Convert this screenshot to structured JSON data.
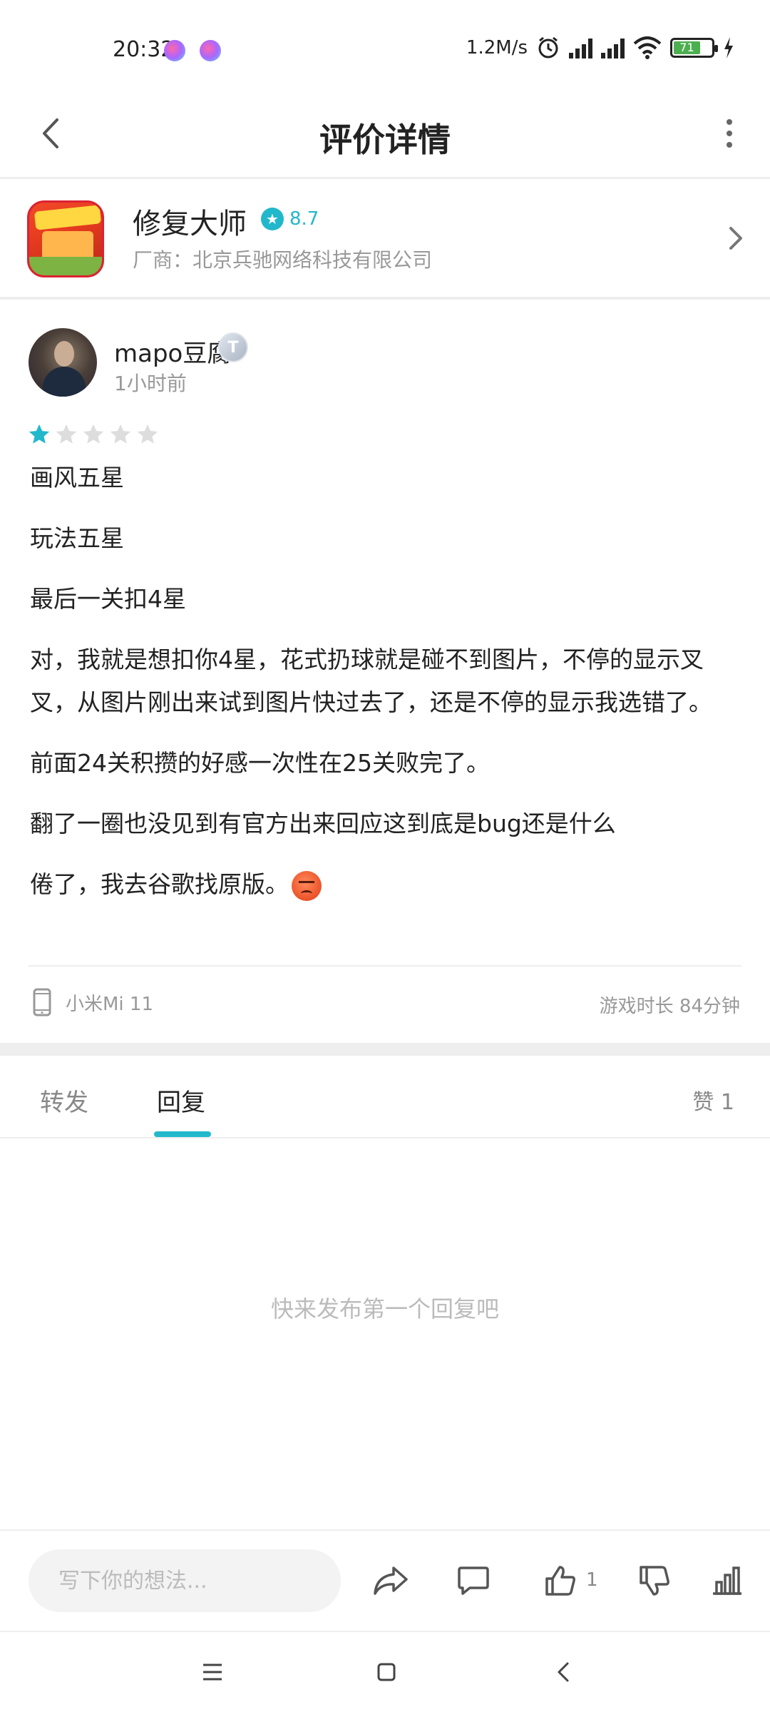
{
  "status_bar": {
    "time": "20:32",
    "net_speed": "1.2M/s",
    "battery": "71"
  },
  "header": {
    "title": "评价详情",
    "back_icon": "chevron-left-icon",
    "more_icon": "more-vertical-icon"
  },
  "app": {
    "name": "修复大师",
    "rating": "8.7",
    "vendor": "厂商：北京兵驰网络科技有限公司"
  },
  "review": {
    "username": "mapo豆腐",
    "level": "T",
    "time_ago": "1小时前",
    "stars": 1,
    "stars_max": 5,
    "paragraphs": [
      "画风五星",
      "玩法五星",
      "最后一关扣4星",
      "对，我就是想扣你4星，花式扔球就是碰不到图片，不停的显示叉叉，从图片刚出来试到图片快过去了，还是不停的显示我选错了。",
      "前面24关积攒的好感一次性在25关败完了。",
      "翻了一圈也没见到有官方出来回应这到底是bug还是什么",
      "倦了，我去谷歌找原版。"
    ],
    "device": "小米Mi 11",
    "playtime": "游戏时长 84分钟"
  },
  "tabs": {
    "forward": "转发",
    "reply": "回复",
    "like": "赞 1"
  },
  "empty_state": "快来发布第一个回复吧",
  "bottom_bar": {
    "placeholder": "写下你的想法...",
    "like_count": "1"
  },
  "colors": {
    "accent": "#22b8cc",
    "star_empty": "#dddddd",
    "text_secondary": "#999999"
  }
}
